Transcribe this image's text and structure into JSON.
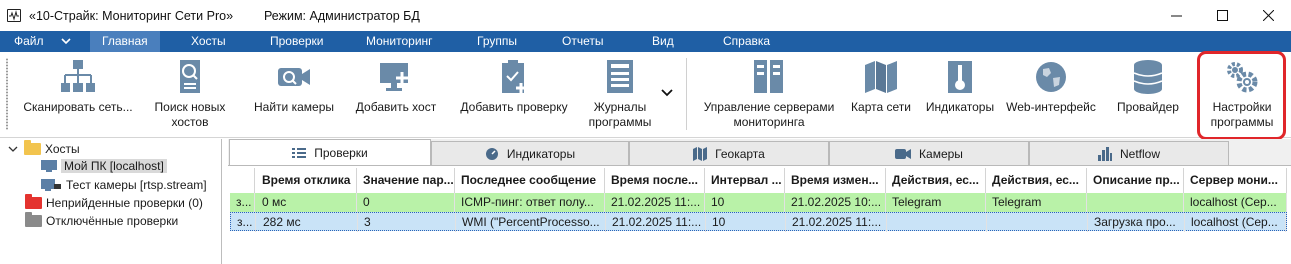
{
  "window": {
    "title": "«10-Страйк: Мониторинг Сети Pro»",
    "mode": "Режим: Администратор БД"
  },
  "menu": {
    "file": "Файл",
    "items": [
      "Главная",
      "Хосты",
      "Проверки",
      "Мониторинг",
      "Группы",
      "Отчеты",
      "Вид",
      "Справка"
    ],
    "active_index": 0
  },
  "ribbon": {
    "scan_network": "Сканировать сеть...",
    "find_new_hosts": "Поиск новых\nхостов",
    "find_cameras": "Найти камеры",
    "add_host": "Добавить хост",
    "add_check": "Добавить проверку",
    "program_logs": "Журналы\nпрограммы",
    "manage_servers": "Управление серверами\nмониторинга",
    "network_map": "Карта сети",
    "indicators": "Индикаторы",
    "web_interface": "Web-интерфейс",
    "provider": "Провайдер",
    "program_settings": "Настройки\nпрограммы"
  },
  "tree": {
    "hosts": "Хосты",
    "my_pc": "Мой ПК [localhost]",
    "camera_test": "Тест камеры [rtsp.stream]",
    "failed_checks": "Неприйденные проверки (0)",
    "disabled_checks": "Отключённые проверки"
  },
  "tabs": [
    "Проверки",
    "Индикаторы",
    "Геокарта",
    "Камеры",
    "Netflow"
  ],
  "table": {
    "headers": [
      "",
      "Время отклика",
      "Значение пар...",
      "Последнее сообщение",
      "Время после...",
      "Интервал ...",
      "Время измен...",
      "Действия, ес...",
      "Действия, ес...",
      "Описание пр...",
      "Сервер мони..."
    ],
    "rows": [
      [
        "з...",
        "0 мс",
        "0",
        "ICMP-пинг: ответ полу...",
        "21.02.2025 11:...",
        "10",
        "21.02.2025 10:...",
        "Telegram",
        "Telegram",
        "",
        "localhost (Сер..."
      ],
      [
        "з...",
        "282 мс",
        "3",
        "WMI (\"PercentProcesso...",
        "21.02.2025 11:...",
        "10",
        "21.02.2025 11:...",
        "",
        "",
        "Загрузка про...",
        "localhost (Сер..."
      ]
    ]
  },
  "colors": {
    "menubar": "#1f5fa5",
    "row_ok": "#b9f2a8",
    "row_selected": "#c9e3f7",
    "highlight": "#e0262a"
  }
}
